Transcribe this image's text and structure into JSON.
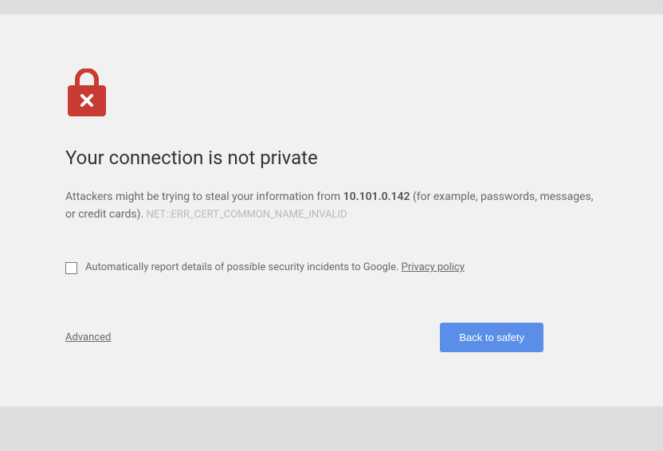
{
  "heading": "Your connection is not private",
  "description": {
    "prefix": "Attackers might be trying to steal your information from ",
    "host": "10.101.0.142",
    "suffix": " (for example, passwords, messages, or credit cards). ",
    "error_code": "NET::ERR_CERT_COMMON_NAME_INVALID"
  },
  "checkbox": {
    "label": "Automatically report details of possible security incidents to Google. ",
    "privacy_link": "Privacy policy"
  },
  "actions": {
    "advanced": "Advanced",
    "back_to_safety": "Back to safety"
  }
}
